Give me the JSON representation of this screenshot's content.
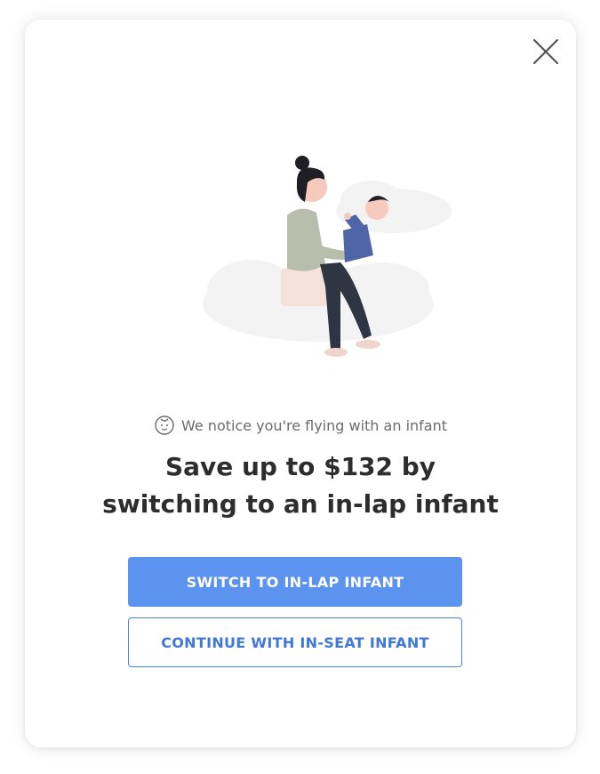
{
  "modal": {
    "close_icon": "close-icon",
    "illustration_icon": "mother-holding-infant-illustration",
    "notice": {
      "icon": "baby-face-icon",
      "text": "We notice you're flying with an infant"
    },
    "headline": {
      "line1": "Save up to $132 by",
      "line2": "switching to an in-lap infant"
    },
    "primary_button_label": "SWITCH TO IN-LAP INFANT",
    "secondary_button_label": "CONTINUE WITH IN-SEAT INFANT"
  },
  "colors": {
    "primary": "#5b93ee",
    "secondary_border": "#4a82e0",
    "headline": "#2d2d2d",
    "notice": "#6b6b6b"
  }
}
